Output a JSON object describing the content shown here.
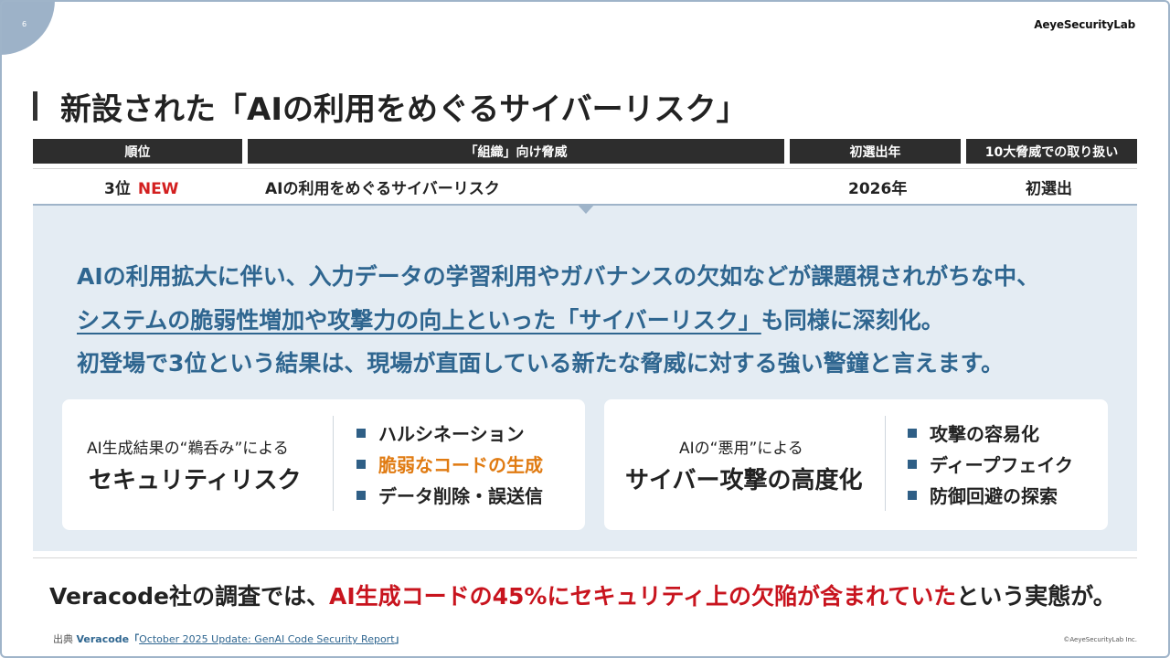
{
  "page_number": "6",
  "logo_text": "AeyeSecurityLab",
  "title": "新設された「AIの利用をめぐるサイバーリスク」",
  "table": {
    "headers": [
      "順位",
      "「組織」向け脅威",
      "初選出年",
      "10大脅威での取り扱い"
    ],
    "row": {
      "rank": "3位",
      "new_badge": "NEW",
      "threat": "AIの利用をめぐるサイバーリスク",
      "year": "2026年",
      "handling": "初選出"
    }
  },
  "lead": {
    "line1": "AIの利用拡大に伴い、入力データの学習利用やガバナンスの欠如などが課題視されがちな中、",
    "line2_underlined": "システムの脆弱性増加や攻撃力の向上といった「サイバーリスク」",
    "line2_rest": "も同様に深刻化。",
    "line3": "初登場で3位という結果は、現場が直面している新たな脅威に対する強い警鐘と言えます。"
  },
  "card_left": {
    "subtitle": "AI生成結果の“鵜呑み”による",
    "main": "セキュリティリスク",
    "bullets": [
      "ハルシネーション",
      "脆弱なコードの生成",
      "データ削除・誤送信"
    ]
  },
  "card_right": {
    "subtitle": "AIの“悪用”による",
    "main": "サイバー攻撃の高度化",
    "bullets": [
      "攻撃の容易化",
      "ディープフェイク",
      "防御回避の探索"
    ]
  },
  "conclusion": {
    "prefix": "Veracode社の調査では、",
    "highlight": "AI生成コードの45%にセキュリティ上の欠陥が含まれていた",
    "suffix": "という実態が。"
  },
  "source": {
    "label": "出典 ",
    "name": "Veracode「",
    "link": "October 2025 Update: GenAI Code Security Report",
    "close": "」"
  },
  "copyright": "©AeyeSecurityLab Inc.",
  "colors": {
    "accent_blue": "#2f6690",
    "panel_bg": "#e4ecf3",
    "header_dark": "#2d2d2d",
    "alert_red": "#c8141e",
    "highlight_orange": "#e07b12"
  }
}
